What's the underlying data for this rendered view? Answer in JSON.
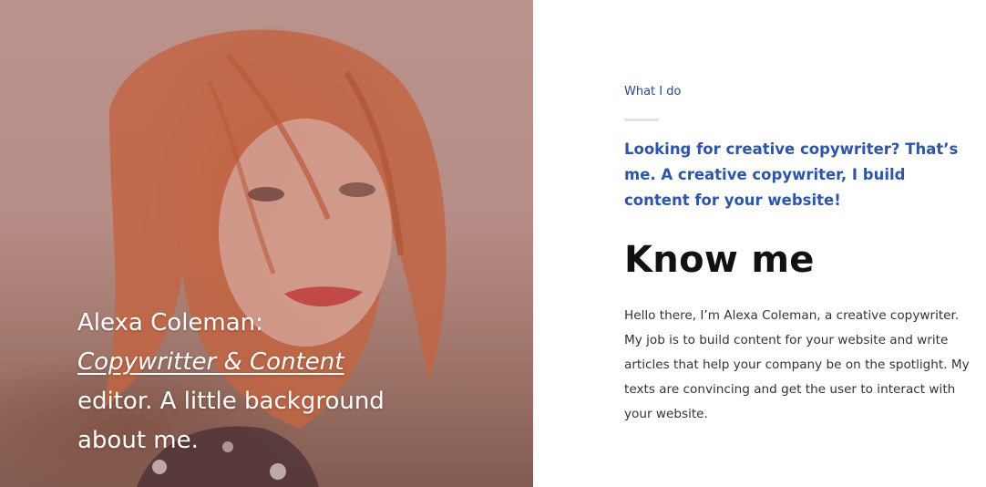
{
  "hero": {
    "caption_line1": "Alexa Coleman:",
    "caption_emphasis": "Copywritter & Content",
    "caption_line3": "editor. A little background",
    "caption_line4": "about me.",
    "overlay_color": "#965a5f"
  },
  "about": {
    "eyebrow": "What I do",
    "lead": "Looking for creative copywriter? That’s me. A creative copywriter, I build content for your website!",
    "heading": "Know me",
    "body": "Hello there, I’m Alexa Coleman, a creative copywriter. My job is to build content for your website and write articles that help your company be on the spotlight. My texts are convincing and get the user to interact with your website."
  },
  "colors": {
    "accent_blue": "#2f56a6",
    "eyebrow_blue": "#2b4a8f",
    "heading": "#111111",
    "body": "#333333"
  }
}
